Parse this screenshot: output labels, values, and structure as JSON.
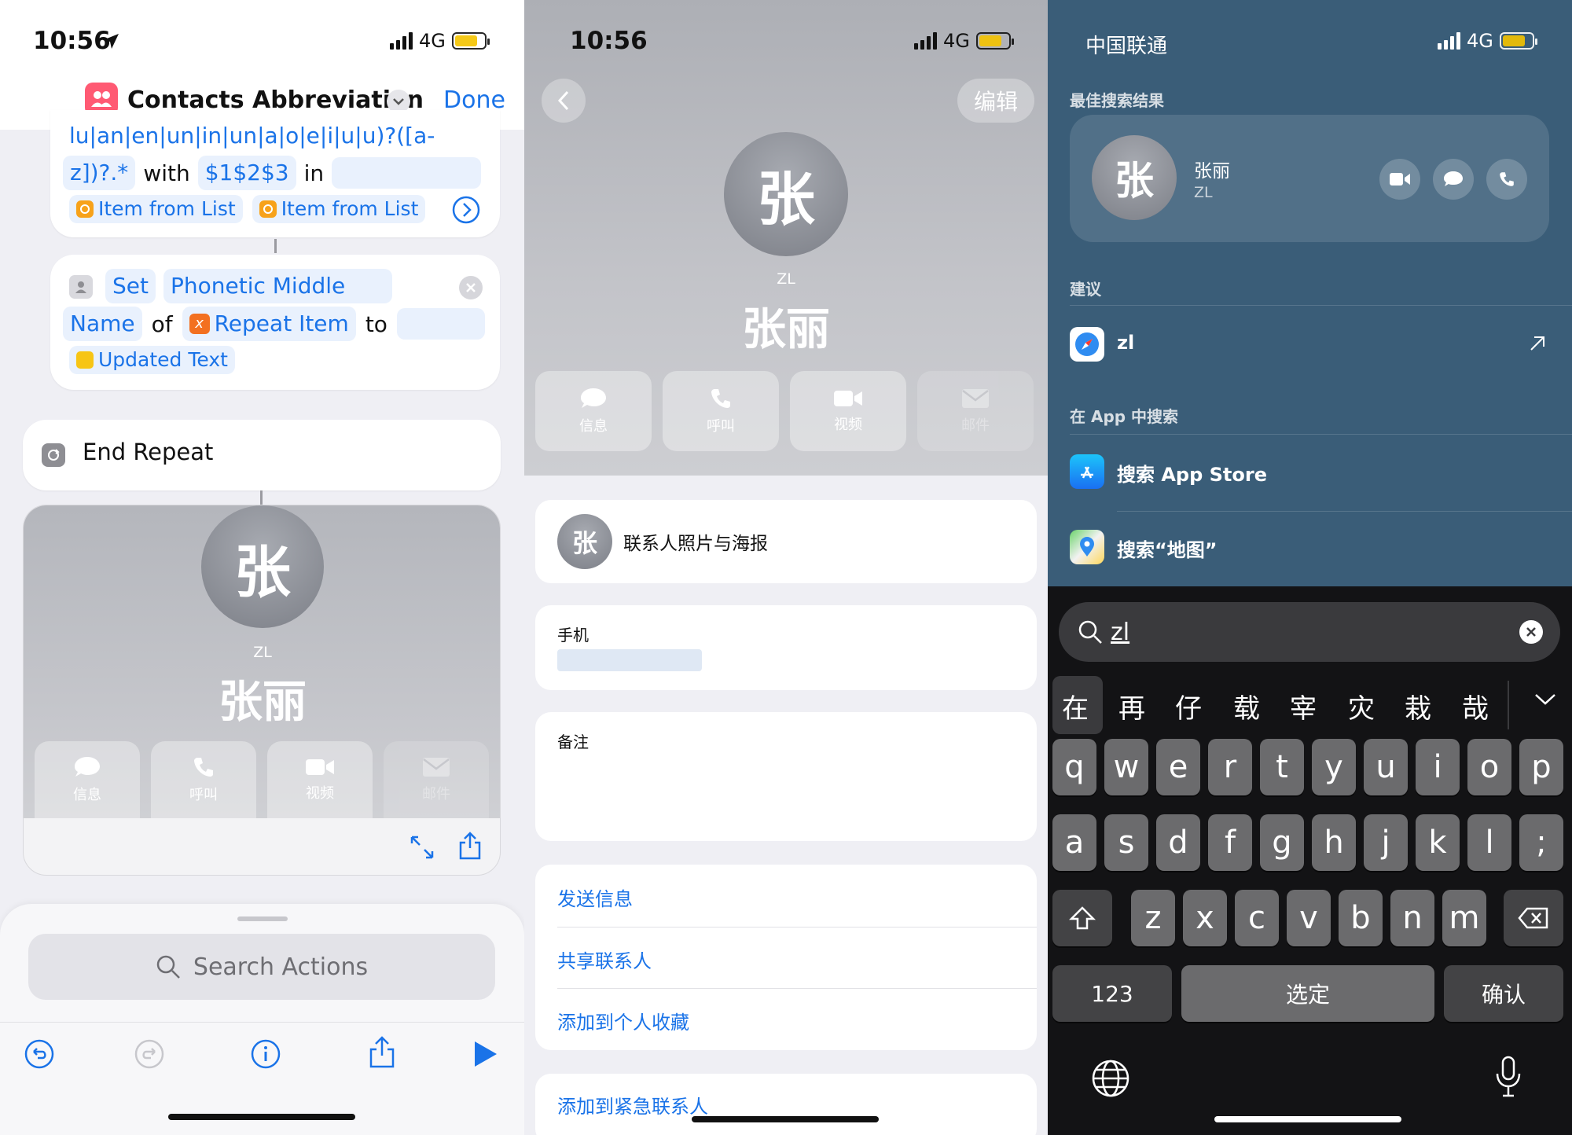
{
  "panel1": {
    "status": {
      "time": "10:56",
      "network": "4G"
    },
    "header": {
      "title": "Contacts Abbreviation",
      "done_label": "Done",
      "accent": "#1a73e8"
    },
    "replace_card": {
      "pattern_fragment": "lu|an|en|un|in|un|a|o|e|i|u|u)?([a-",
      "pattern_end": "z])?.*",
      "with_label": "with",
      "replacement": "$1$2$3",
      "in_label": "in",
      "item1": "Item from List",
      "item2": "Item from List"
    },
    "set_card": {
      "set_label": "Set",
      "field": "Phonetic Middle",
      "field2": "Name",
      "of_label": "of",
      "var": "Repeat Item",
      "to_label": "to",
      "value": "Updated Text"
    },
    "end_repeat": {
      "label": "End Repeat"
    },
    "preview": {
      "avatar": "张",
      "initials": "ZL",
      "name": "张丽",
      "actions": [
        {
          "label": "信息",
          "icon": "message-bubble-icon"
        },
        {
          "label": "呼叫",
          "icon": "phone-icon"
        },
        {
          "label": "视频",
          "icon": "video-icon"
        },
        {
          "label": "邮件",
          "icon": "mail-icon"
        }
      ]
    },
    "search": {
      "placeholder": "Search Actions"
    }
  },
  "panel2": {
    "status": {
      "time": "10:56",
      "network": "4G"
    },
    "edit_label": "编辑",
    "avatar": "张",
    "initials": "ZL",
    "name": "张丽",
    "actions": [
      {
        "label": "信息",
        "icon": "message-bubble-icon"
      },
      {
        "label": "呼叫",
        "icon": "phone-icon"
      },
      {
        "label": "视频",
        "icon": "video-icon"
      },
      {
        "label": "邮件",
        "icon": "mail-icon"
      }
    ],
    "poster_row": {
      "avatar": "张",
      "label": "联系人照片与海报"
    },
    "phone_label": "手机",
    "notes_label": "备注",
    "options": [
      "发送信息",
      "共享联系人",
      "添加到个人收藏"
    ],
    "emergency": "添加到紧急联系人"
  },
  "panel3": {
    "status": {
      "carrier": "中国联通",
      "network": "4G"
    },
    "top_hit_header": "最佳搜索结果",
    "top_hit": {
      "avatar": "张",
      "name": "张丽",
      "sub": "ZL"
    },
    "suggest_header": "建议",
    "suggestion": "zl",
    "in_app_header": "在 App 中搜索",
    "app_results": [
      "搜索 App Store",
      "搜索“地图”"
    ],
    "query": "zl",
    "candidates": [
      "在",
      "再",
      "仔",
      "载",
      "宰",
      "灾",
      "栽",
      "哉"
    ],
    "keys_row1": [
      "q",
      "w",
      "e",
      "r",
      "t",
      "y",
      "u",
      "i",
      "o",
      "p"
    ],
    "keys_row2": [
      "a",
      "s",
      "d",
      "f",
      "g",
      "h",
      "j",
      "k",
      "l",
      ";"
    ],
    "keys_row3": [
      "z",
      "x",
      "c",
      "v",
      "b",
      "n",
      "m"
    ],
    "key_123": "123",
    "key_space": "选定",
    "key_confirm": "确认"
  }
}
